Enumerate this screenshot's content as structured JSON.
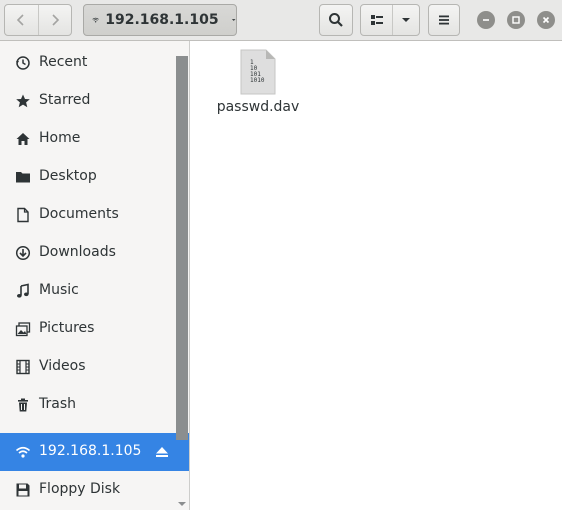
{
  "header": {
    "location": "192.168.1.105"
  },
  "sidebar": {
    "items": [
      {
        "label": "Recent",
        "icon": "clock-icon"
      },
      {
        "label": "Starred",
        "icon": "star-icon"
      },
      {
        "label": "Home",
        "icon": "home-icon"
      },
      {
        "label": "Desktop",
        "icon": "folder-icon"
      },
      {
        "label": "Documents",
        "icon": "document-icon"
      },
      {
        "label": "Downloads",
        "icon": "download-icon"
      },
      {
        "label": "Music",
        "icon": "music-icon"
      },
      {
        "label": "Pictures",
        "icon": "pictures-icon"
      },
      {
        "label": "Videos",
        "icon": "film-icon"
      },
      {
        "label": "Trash",
        "icon": "trash-icon"
      }
    ],
    "network_item": {
      "label": "192.168.1.105",
      "icon": "wifi-icon",
      "selected": true
    },
    "floppy": {
      "label": "Floppy Disk",
      "icon": "floppy-icon"
    }
  },
  "files": [
    {
      "name": "passwd.dav",
      "icon": "binary-file-icon",
      "icon_text": [
        "1",
        "10",
        "101",
        "1010"
      ]
    }
  ],
  "colors": {
    "accent": "#3584e4",
    "sidebar_bg": "#f6f5f4",
    "header_bg": "#e8e8e7"
  }
}
